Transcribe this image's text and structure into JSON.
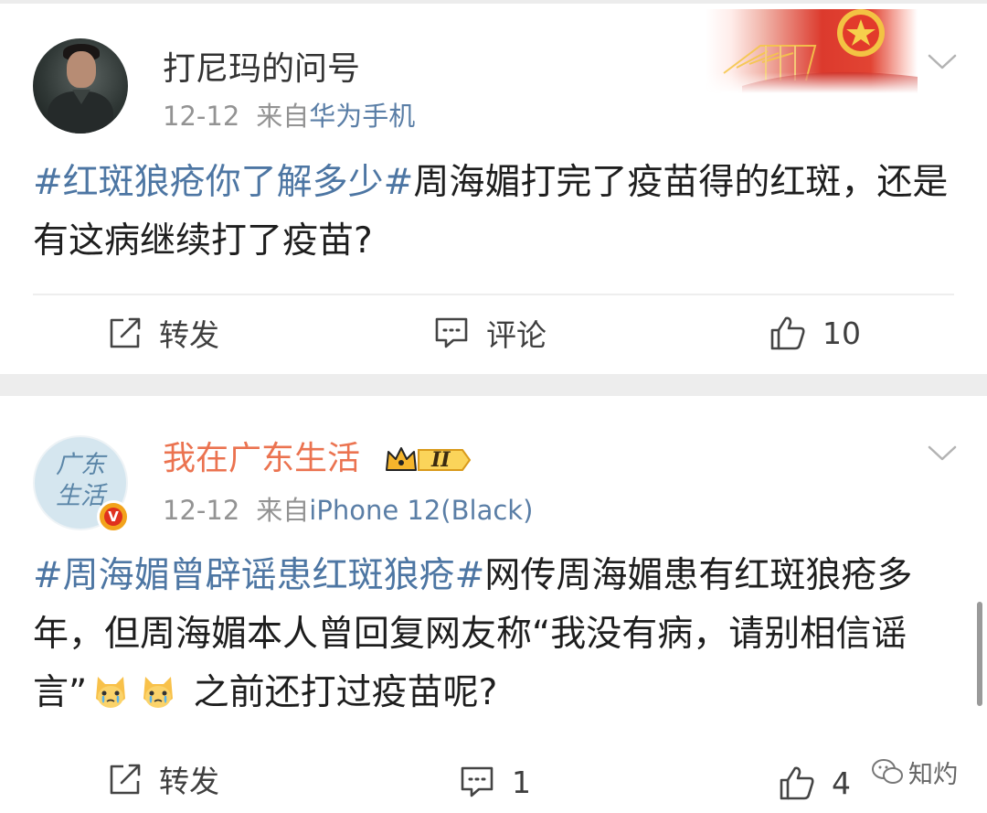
{
  "post1": {
    "username": "打尼玛的问号",
    "time": "12-12",
    "from_label": "来自",
    "source": "华为手机",
    "topic": "#红斑狼疮你了解多少#",
    "text": "周海媚打完了疫苗得的红斑，还是有这病继续打了疫苗?",
    "actions": {
      "repost": "转发",
      "comment": "评论",
      "likes": "10"
    }
  },
  "post2": {
    "username": "我在广东生活",
    "avatar_text_line1": "广东",
    "avatar_text_line2": "生活",
    "verified_badge": "V",
    "level_badge": "II",
    "time": "12-12",
    "from_label": "来自",
    "source": "iPhone 12(Black)",
    "topic": "#周海媚曾辟谣患红斑狼疮#",
    "text_before_emoji": "网传周海媚患有红斑狼疮多年，但周海媚本人曾回复网友称“我没有病，请别相信谣言”",
    "emojis": [
      "crying-cat-emoji",
      "crying-cat-emoji"
    ],
    "text_after_emoji": "之前还打过疫苗呢?",
    "actions": {
      "repost": "转发",
      "comment": "1",
      "likes": "4"
    }
  },
  "watermark": "知灼",
  "colors": {
    "topic": "#4d76a3",
    "source_link": "#5a7ea6",
    "vip_name": "#eb7350",
    "meta_gray": "#939393",
    "separator": "#ededed"
  }
}
